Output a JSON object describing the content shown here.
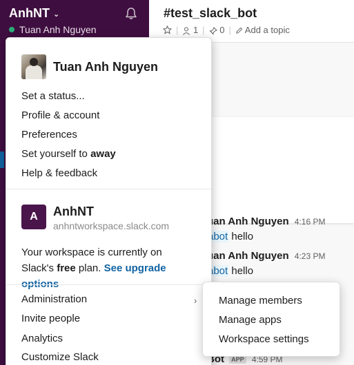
{
  "sidebar": {
    "workspace_name": "AnhNT",
    "user_name": "Tuan Anh Nguyen"
  },
  "channel": {
    "title": "#test_slack_bot",
    "members": "1",
    "pinned": "0",
    "add_topic": "Add a topic"
  },
  "messages": [
    {
      "sender": "uan Anh Nguyen",
      "time": "4:16 PM",
      "mention": "abot",
      "text": "hello"
    },
    {
      "sender": "uan Anh Nguyen",
      "time": "4:23 PM",
      "mention": "abot",
      "text": "hello"
    },
    {
      "sender": "Bot",
      "badge": "APP",
      "time": "4:59 PM"
    }
  ],
  "menu": {
    "user_name": "Tuan Anh Nguyen",
    "set_status": "Set a status...",
    "profile": "Profile & account",
    "preferences": "Preferences",
    "set_away_prefix": "Set yourself to ",
    "set_away_bold": "away",
    "help": "Help & feedback",
    "workspace_initial": "A",
    "workspace_name": "AnhNT",
    "workspace_domain": "anhntworkspace.slack.com",
    "plan_line1": "Your workspace is currently on",
    "plan_prefix": "Slack's ",
    "plan_bold": "free",
    "plan_suffix": " plan. ",
    "plan_link": "See upgrade options",
    "administration": "Administration",
    "invite": "Invite people",
    "analytics": "Analytics",
    "customize": "Customize Slack"
  },
  "submenu": {
    "manage_members": "Manage members",
    "manage_apps": "Manage apps",
    "workspace_settings": "Workspace settings"
  },
  "colors": {
    "sidebar_bg": "#3f0e40",
    "presence": "#2bac76",
    "link": "#1264a3"
  }
}
